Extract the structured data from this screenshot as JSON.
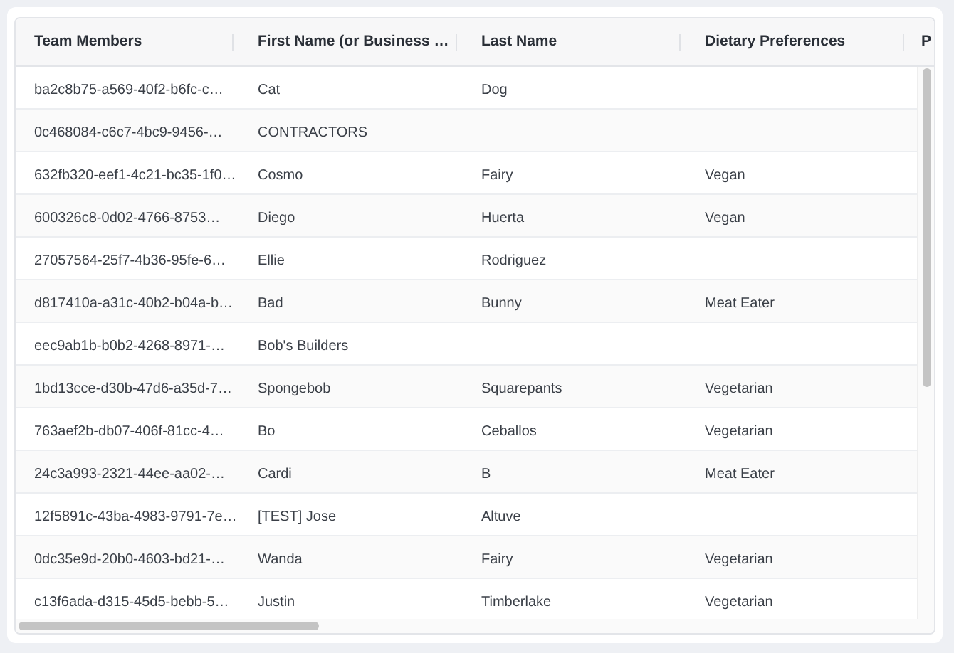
{
  "table": {
    "columns": [
      "Team Members",
      "First Name (or Business …",
      "Last Name",
      "Dietary Preferences",
      "P"
    ],
    "rows": [
      {
        "team_members": "ba2c8b75-a569-40f2-b6fc-c…",
        "first_name": "Cat",
        "last_name": "Dog"
      },
      {
        "team_members": "0c468084-c6c7-4bc9-9456-…",
        "first_name": "CONTRACTORS"
      },
      {
        "team_members": "632fb320-eef1-4c21-bc35-1f0…",
        "first_name": "Cosmo",
        "last_name": "Fairy",
        "dietary_preferences": "Vegan"
      },
      {
        "team_members": "600326c8-0d02-4766-8753…",
        "first_name": "Diego",
        "last_name": "Huerta",
        "dietary_preferences": "Vegan"
      },
      {
        "team_members": "27057564-25f7-4b36-95fe-6…",
        "first_name": "Ellie",
        "last_name": "Rodriguez"
      },
      {
        "team_members": "d817410a-a31c-40b2-b04a-b…",
        "first_name": "Bad",
        "last_name": "Bunny",
        "dietary_preferences": "Meat Eater"
      },
      {
        "team_members": "eec9ab1b-b0b2-4268-8971-…",
        "first_name": "Bob's Builders"
      },
      {
        "team_members": "1bd13cce-d30b-47d6-a35d-7…",
        "first_name": "Spongebob",
        "last_name": "Squarepants",
        "dietary_preferences": "Vegetarian"
      },
      {
        "team_members": "763aef2b-db07-406f-81cc-4…",
        "first_name": "Bo",
        "last_name": "Ceballos",
        "dietary_preferences": "Vegetarian"
      },
      {
        "team_members": "24c3a993-2321-44ee-aa02-…",
        "first_name": "Cardi",
        "last_name": "B",
        "dietary_preferences": "Meat Eater"
      },
      {
        "team_members": "12f5891c-43ba-4983-9791-7e…",
        "first_name": "[TEST] Jose",
        "last_name": "Altuve"
      },
      {
        "team_members": "0dc35e9d-20b0-4603-bd21-…",
        "first_name": "Wanda",
        "last_name": "Fairy",
        "dietary_preferences": "Vegetarian"
      },
      {
        "team_members": "c13f6ada-d315-45d5-bebb-5…",
        "first_name": "Justin",
        "last_name": "Timberlake",
        "dietary_preferences": "Vegetarian"
      }
    ]
  }
}
